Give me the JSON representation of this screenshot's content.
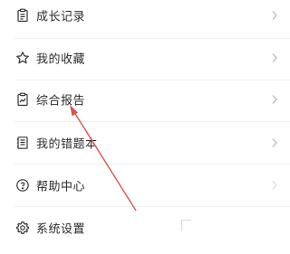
{
  "menu": {
    "items": [
      {
        "label": "成长记录",
        "icon": "clipboard-icon"
      },
      {
        "label": "我的收藏",
        "icon": "star-icon"
      },
      {
        "label": "综合报告",
        "icon": "report-chart-icon"
      },
      {
        "label": "我的错题本",
        "icon": "notebook-icon"
      },
      {
        "label": "帮助中心",
        "icon": "help-circle-icon"
      },
      {
        "label": "系统设置",
        "icon": "gear-icon"
      }
    ]
  },
  "colors": {
    "text": "#2b2b2b",
    "icon": "#333333",
    "chevron": "#b5b5b5",
    "divider": "#eeeeee",
    "annotation_arrow": "#d9534f"
  }
}
